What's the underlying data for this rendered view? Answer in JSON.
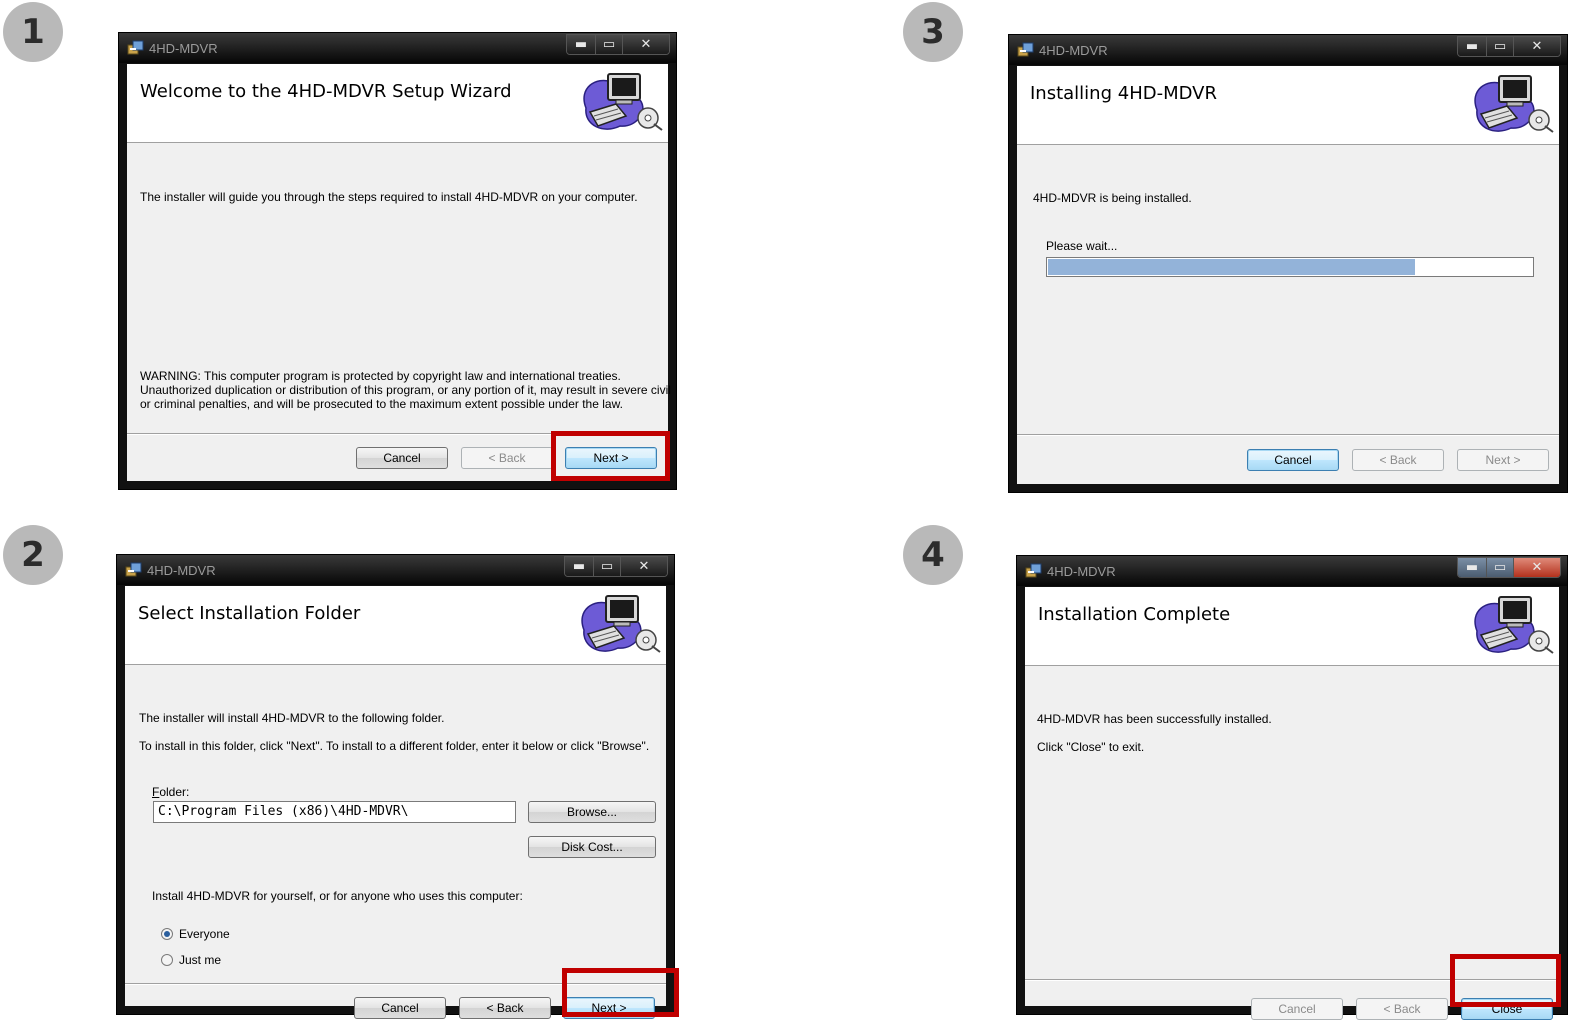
{
  "steps": [
    "1",
    "2",
    "3",
    "4"
  ],
  "window": {
    "title": "4HD-MDVR",
    "controls": {
      "minimize": "▬",
      "maximize": "▭",
      "close": "✕"
    }
  },
  "dialog1": {
    "heading": "Welcome to the 4HD-MDVR Setup Wizard",
    "intro": "The installer will guide you through the steps required to install 4HD-MDVR on your computer.",
    "warning": [
      "WARNING: This computer program is protected by copyright law and international treaties.",
      "Unauthorized duplication or distribution of this program, or any portion of it, may result in severe civil",
      "or criminal penalties, and will be prosecuted to the maximum extent possible under the law."
    ],
    "buttons": {
      "cancel": "Cancel",
      "back": "< Back",
      "next": "Next >"
    }
  },
  "dialog2": {
    "heading": "Select Installation Folder",
    "line1": "The installer will install 4HD-MDVR to the following folder.",
    "line2": "To install in this folder, click \"Next\". To install to a different folder, enter it below or click \"Browse\".",
    "folder_label_first": "F",
    "folder_label_rest": "older:",
    "folder_value": "C:\\Program Files (x86)\\4HD-MDVR\\",
    "browse": "Browse...",
    "disk_cost": "Disk Cost...",
    "install_for": "Install 4HD-MDVR for yourself, or for anyone who uses this computer:",
    "radio_everyone": "Everyone",
    "radio_just_me": "Just me",
    "radio_selected": "Everyone",
    "buttons": {
      "cancel": "Cancel",
      "back": "< Back",
      "next": "Next >"
    }
  },
  "dialog3": {
    "heading": "Installing 4HD-MDVR",
    "status": "4HD-MDVR is being installed.",
    "wait": "Please wait...",
    "progress": 0.76,
    "buttons": {
      "cancel": "Cancel",
      "back": "< Back",
      "next": "Next >"
    }
  },
  "dialog4": {
    "heading": "Installation Complete",
    "line1": "4HD-MDVR has been successfully installed.",
    "line2": "Click \"Close\" to exit.",
    "buttons": {
      "cancel": "Cancel",
      "back": "< Back",
      "close": "Close"
    }
  },
  "colors": {
    "highlight": "#c00000",
    "progress_fill": "#93b3d9",
    "step_circle": "#b9b9b9"
  },
  "icons": {
    "titlebar": "installer-icon",
    "banner": "computer-setup-icon"
  }
}
